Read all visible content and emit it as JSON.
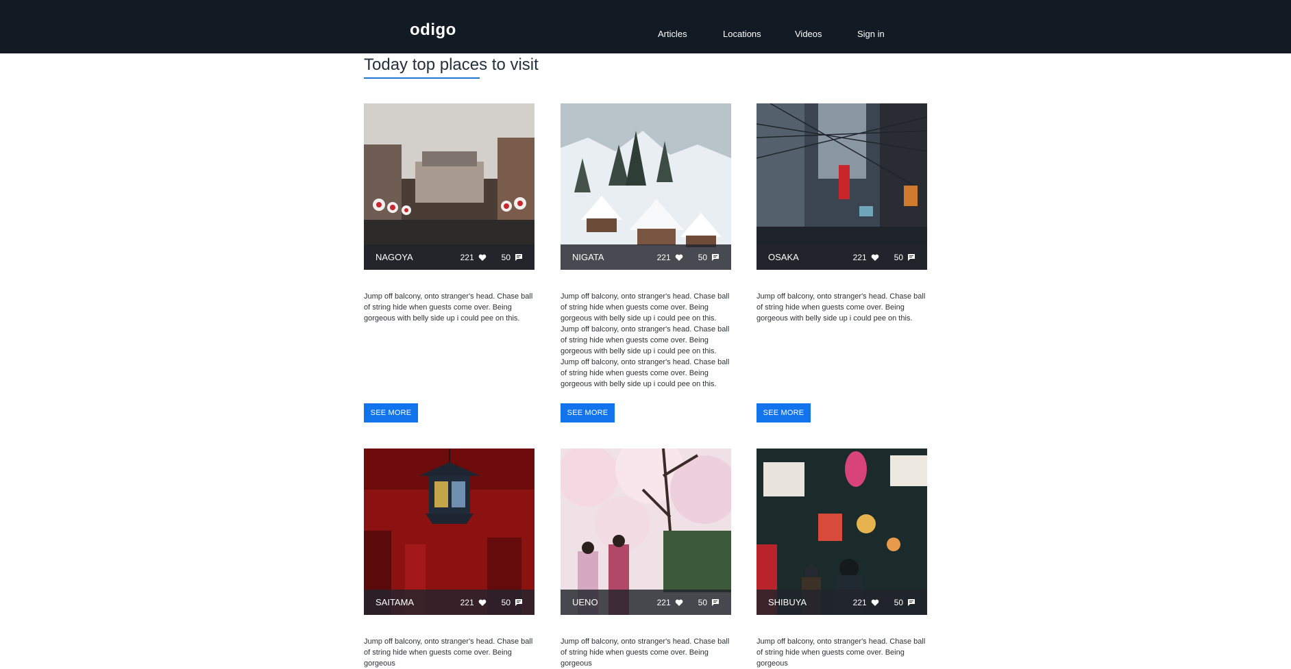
{
  "header": {
    "logo": "odigo",
    "nav": [
      "Articles",
      "Locations",
      "Videos",
      "Sign in"
    ]
  },
  "main": {
    "heading": "Today top places to visit",
    "cards": [
      {
        "place": "NAGOYA",
        "likes": "221",
        "comments": "50",
        "button": "SEE MORE",
        "desc": "Jump off balcony, onto stranger's head. Chase ball of string hide when guests come over. Being gorgeous with belly side up i could pee on this."
      },
      {
        "place": "NIGATA",
        "likes": "221",
        "comments": "50",
        "button": "SEE MORE",
        "desc": "Jump off balcony, onto stranger's head. Chase ball of string hide when guests come over. Being gorgeous with belly side up i could pee on this. Jump off balcony, onto stranger's head. Chase ball of string hide when guests come over. Being gorgeous with belly side up i could pee on this. Jump off balcony, onto stranger's head. Chase ball of string hide when guests come over. Being gorgeous with belly side up i could pee on this."
      },
      {
        "place": "OSAKA",
        "likes": "221",
        "comments": "50",
        "button": "SEE MORE",
        "desc": "Jump off balcony, onto stranger's head. Chase ball of string hide when guests come over. Being gorgeous with belly side up i could pee on this."
      },
      {
        "place": "SAITAMA",
        "likes": "221",
        "comments": "50",
        "desc": "Jump off balcony, onto stranger's head. Chase ball of string hide when guests come over. Being gorgeous"
      },
      {
        "place": "UENO",
        "likes": "221",
        "comments": "50",
        "desc": "Jump off balcony, onto stranger's head. Chase ball of string hide when guests come over. Being gorgeous"
      },
      {
        "place": "SHIBUYA",
        "likes": "221",
        "comments": "50",
        "desc": "Jump off balcony, onto stranger's head. Chase ball of string hide when guests come over. Being gorgeous"
      }
    ]
  },
  "icons": {
    "likes": "heart-icon",
    "comments": "comment-icon"
  },
  "colors": {
    "topbar": "#121b24",
    "accent": "#1174ed",
    "heading_underline": "#1976d2"
  }
}
